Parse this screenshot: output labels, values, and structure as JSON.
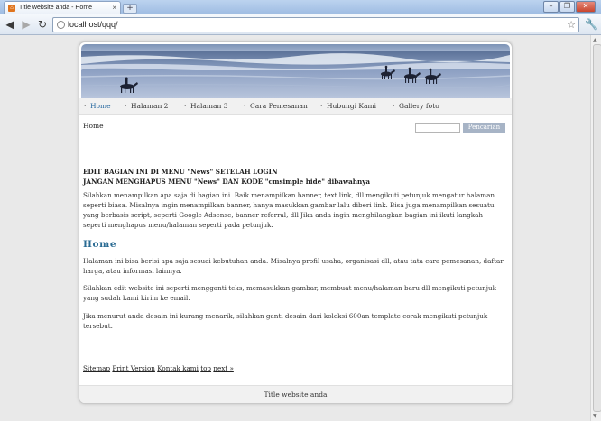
{
  "browser": {
    "tab_title": "Title website anda - Home",
    "tab_close": "×",
    "new_tab": "+",
    "url": "localhost/qqq/",
    "window_buttons": [
      "–",
      "❐",
      "✕"
    ],
    "nav": {
      "back": "◀",
      "forward": "▶",
      "reload": "↻"
    }
  },
  "page": {
    "menu": [
      {
        "label": "Home",
        "active": true
      },
      {
        "label": "Halaman 2",
        "active": false
      },
      {
        "label": "Halaman 3",
        "active": false
      },
      {
        "label": "Cara Pemesanan",
        "active": false
      },
      {
        "label": "Hubungi Kami",
        "active": false
      },
      {
        "label": "Gallery foto",
        "active": false
      }
    ],
    "breadcrumb": "Home",
    "search": {
      "value": "",
      "button": "Pencarian"
    },
    "notice": {
      "line1": "EDIT BAGIAN INI DI MENU \"News\" SETELAH LOGIN",
      "line2": "JANGAN MENGHAPUS MENU \"News\" DAN KODE \"cmsimple hide\" dibawahnya"
    },
    "notice_paragraph": "Silahkan menampilkan apa saja di bagian ini. Baik menampilkan banner, text link, dll mengikuti petunjuk mengatur halaman seperti biasa. Misalnya ingin menampilkan banner, hanya masukkan gambar lalu diberi link. Bisa juga menampilkan sesuatu yang berbasis script, seperti Google Adsense, banner referral, dll Jika anda ingin menghilangkan bagian ini ikuti langkah seperti menghapus menu/halaman seperti pada petunjuk.",
    "heading": "Home",
    "paragraphs": [
      "Halaman ini bisa berisi apa saja sesuai kebutuhan anda. Misalnya profil usaha, organisasi dll, atau tata cara pemesanan, daftar harga, atau informasi lainnya.",
      "Silahkan edit website ini seperti mengganti teks, memasukkan gambar, membuat menu/halaman baru dll mengikuti petunjuk yang sudah kami kirim ke email.",
      "Jika menurut anda desain ini kurang menarik, silahkan ganti desain dari koleksi 600an template corak mengikuti petunjuk tersebut."
    ],
    "footer_links": [
      "Sitemap",
      "Print Version",
      "Kontak kami",
      "top",
      "next »"
    ],
    "footer": "Title website anda"
  }
}
